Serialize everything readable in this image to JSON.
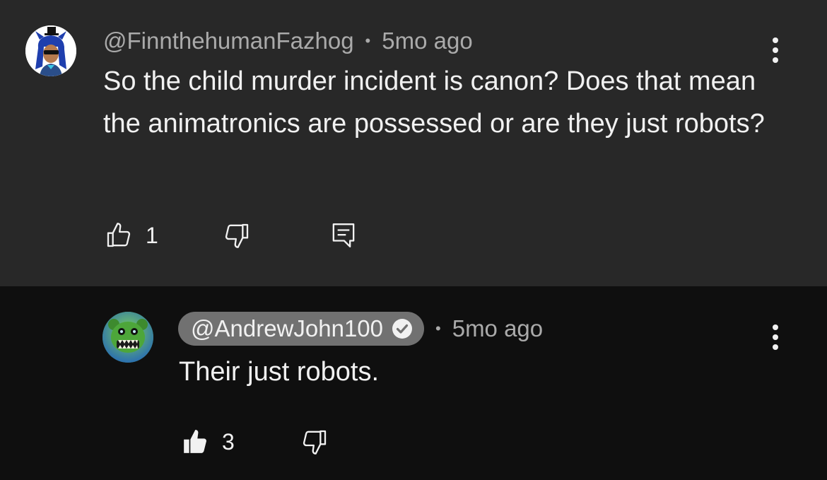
{
  "comment": {
    "author": "@FinnthehumanFazhog",
    "separator": "•",
    "time": "5mo ago",
    "text": "So the child murder incident is canon? Does that mean the animatronics are possessed or are they just robots?",
    "like_count": "1",
    "like_icon": "thumbs-up-outline-icon",
    "dislike_icon": "thumbs-down-outline-icon",
    "reply_icon": "comment-reply-icon",
    "menu_icon": "more-vertical-icon"
  },
  "reply": {
    "author": "@AndrewJohn100",
    "verified_icon": "verified-check-icon",
    "separator": "•",
    "time": "5mo ago",
    "text": "Their just robots.",
    "like_count": "3",
    "like_icon": "thumbs-up-filled-icon",
    "dislike_icon": "thumbs-down-outline-icon",
    "menu_icon": "more-vertical-icon"
  },
  "colors": {
    "top_background": "#282828",
    "reply_background": "#0f0f0f",
    "primary_text": "#f1f1f1",
    "secondary_text": "#aaaaaa",
    "author_pill": "#717171"
  }
}
